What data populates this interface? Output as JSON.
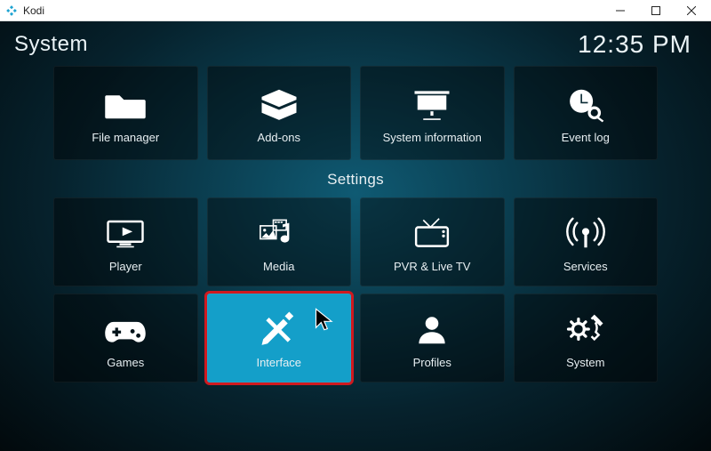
{
  "window": {
    "app_name": "Kodi"
  },
  "header": {
    "page_title": "System",
    "clock": "12:35 PM"
  },
  "top_row": [
    {
      "id": "file-manager",
      "label": "File manager"
    },
    {
      "id": "add-ons",
      "label": "Add-ons"
    },
    {
      "id": "system-information",
      "label": "System information"
    },
    {
      "id": "event-log",
      "label": "Event log"
    }
  ],
  "settings_heading": "Settings",
  "settings_row1": [
    {
      "id": "player",
      "label": "Player"
    },
    {
      "id": "media",
      "label": "Media"
    },
    {
      "id": "pvr",
      "label": "PVR & Live TV"
    },
    {
      "id": "services",
      "label": "Services"
    }
  ],
  "settings_row2": [
    {
      "id": "games",
      "label": "Games"
    },
    {
      "id": "interface",
      "label": "Interface",
      "selected": true
    },
    {
      "id": "profiles",
      "label": "Profiles"
    },
    {
      "id": "system",
      "label": "System"
    }
  ],
  "colors": {
    "accent": "#149fc9",
    "highlight_border": "#d0191f"
  }
}
